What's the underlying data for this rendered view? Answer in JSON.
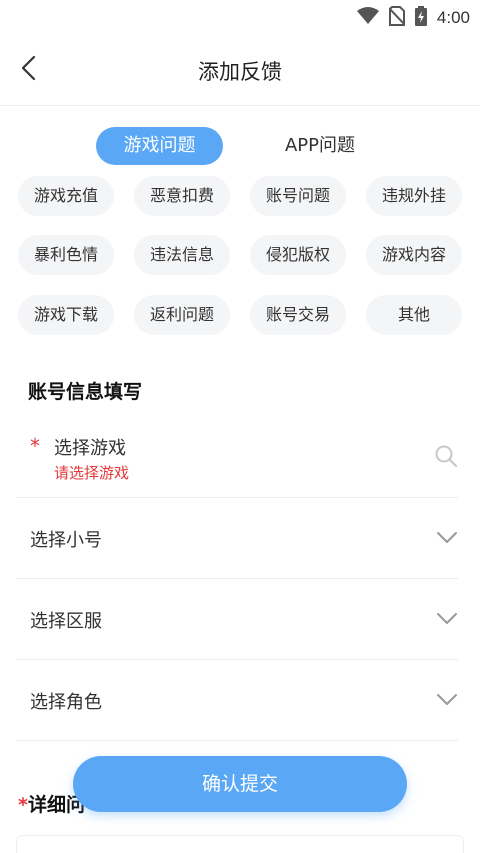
{
  "status_bar": {
    "time": "4:00",
    "icons": [
      "wifi-icon",
      "no-sim-icon",
      "battery-icon"
    ]
  },
  "header": {
    "title": "添加反馈",
    "back_icon": "chevron-left-icon"
  },
  "tabs": [
    {
      "label": "游戏问题",
      "active": true
    },
    {
      "label": "APP问题",
      "active": false
    }
  ],
  "categories": [
    "游戏充值",
    "恶意扣费",
    "账号问题",
    "违规外挂",
    "暴利色情",
    "违法信息",
    "侵犯版权",
    "游戏内容",
    "游戏下载",
    "返利问题",
    "账号交易",
    "其他"
  ],
  "account_section": {
    "title": "账号信息填写",
    "select_game": {
      "required_mark": "*",
      "label": "选择游戏",
      "error": "请选择游戏",
      "icon": "search-icon"
    },
    "select_account": {
      "label": "选择小号",
      "icon": "chevron-down-icon"
    },
    "select_server": {
      "label": "选择区服",
      "icon": "chevron-down-icon"
    },
    "select_role": {
      "label": "选择角色",
      "icon": "chevron-down-icon"
    }
  },
  "detail_section": {
    "required_mark": "*",
    "title_visible": "详细问"
  },
  "submit": {
    "label": "确认提交"
  },
  "colors": {
    "accent": "#5aa8f5",
    "error": "#e5383b",
    "chip_bg": "#f4f5f7",
    "divider": "#ececec"
  }
}
